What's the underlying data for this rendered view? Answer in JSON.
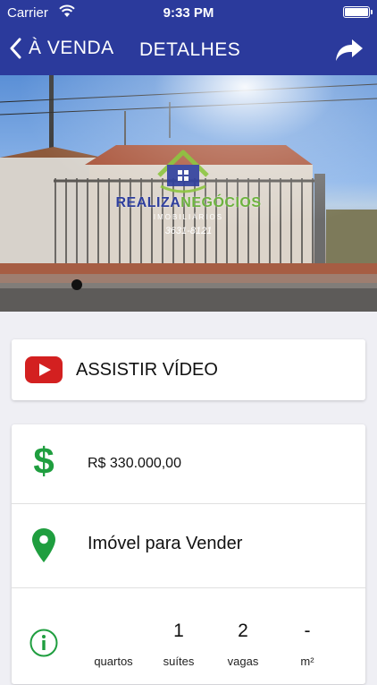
{
  "status_bar": {
    "carrier": "Carrier",
    "time": "9:33 PM"
  },
  "nav": {
    "back_label": "À VENDA",
    "title": "DETALHES",
    "share_icon": "share-icon"
  },
  "photo": {
    "watermark": {
      "brand_part1": "REALIZA",
      "brand_part2": "NEGÓCIOS",
      "subtitle": "IMOBILIÁRIOS",
      "phone": "3631-8121"
    },
    "page_index": 1
  },
  "video": {
    "label": "ASSISTIR VÍDEO",
    "icon": "youtube-icon"
  },
  "details": {
    "price": "R$ 330.000,00",
    "type": "Imóvel para Vender",
    "stats": [
      {
        "value": "",
        "label": "quartos"
      },
      {
        "value": "1",
        "label": "suítes"
      },
      {
        "value": "2",
        "label": "vagas"
      },
      {
        "value": "-",
        "label": "m²"
      }
    ]
  },
  "colors": {
    "nav_background": "#2b3a9c",
    "accent_green": "#1f9e3f",
    "youtube_red": "#d32020"
  }
}
